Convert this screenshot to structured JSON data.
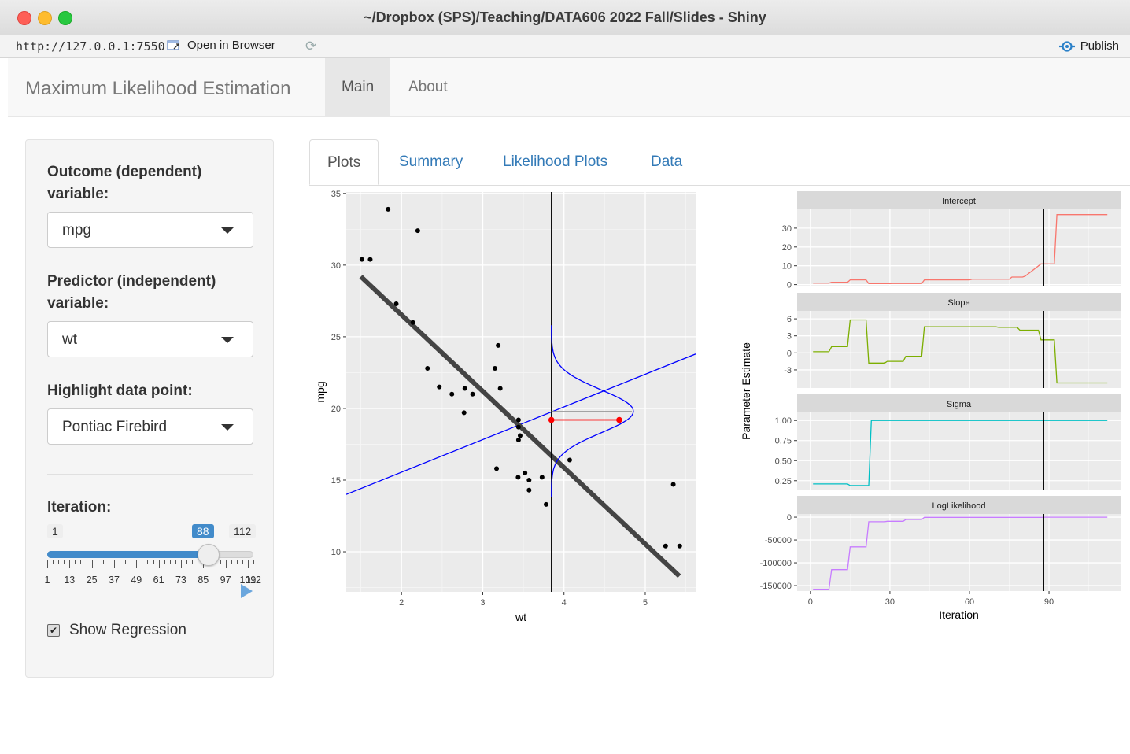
{
  "window": {
    "title": "~/Dropbox (SPS)/Teaching/DATA606 2022 Fall/Slides - Shiny"
  },
  "viewer": {
    "url": "http://127.0.0.1:7550",
    "open_label": "Open in Browser",
    "publish_label": "Publish"
  },
  "navbar": {
    "brand": "Maximum Likelihood Estimation",
    "items": [
      "Main",
      "About"
    ]
  },
  "sidebar": {
    "outcome_label_line1": "Outcome (dependent)",
    "outcome_label_line2": "variable:",
    "outcome_value": "mpg",
    "predictor_label_line1": "Predictor (independent)",
    "predictor_label_line2": "variable:",
    "predictor_value": "wt",
    "highlight_label": "Highlight data point:",
    "highlight_value": "Pontiac Firebird",
    "iteration_label": "Iteration:",
    "slider": {
      "min": "1",
      "max": "112",
      "value": "88",
      "ticks": [
        "1",
        "13",
        "25",
        "37",
        "49",
        "61",
        "73",
        "85",
        "97",
        "109",
        "112"
      ]
    },
    "show_regression_label": "Show Regression",
    "show_regression_checked": true
  },
  "tabs": [
    "Plots",
    "Summary",
    "Likelihood Plots",
    "Data"
  ],
  "colors": {
    "link": "#337ab7",
    "slider": "#428bca",
    "intercept": "#f8766d",
    "slope": "#7cae00",
    "sigma": "#00bfc4",
    "loglik": "#c77cff"
  },
  "chart_data": [
    {
      "type": "scatter",
      "xlabel": "wt",
      "ylabel": "mpg",
      "xticks": [
        "2",
        "3",
        "4",
        "5"
      ],
      "yticks": [
        "10",
        "15",
        "20",
        "25",
        "30",
        "35"
      ],
      "xlim": [
        1.32,
        5.62
      ],
      "ylim": [
        7.2,
        35.1
      ],
      "points": [
        [
          1.513,
          30.4
        ],
        [
          1.615,
          30.4
        ],
        [
          1.835,
          33.9
        ],
        [
          1.935,
          27.3
        ],
        [
          2.14,
          26.0
        ],
        [
          2.2,
          32.4
        ],
        [
          2.32,
          22.8
        ],
        [
          2.465,
          21.5
        ],
        [
          2.62,
          21.0
        ],
        [
          2.77,
          19.7
        ],
        [
          2.78,
          21.4
        ],
        [
          2.875,
          21.0
        ],
        [
          3.15,
          22.8
        ],
        [
          3.17,
          15.8
        ],
        [
          3.19,
          24.4
        ],
        [
          3.215,
          21.4
        ],
        [
          3.435,
          15.2
        ],
        [
          3.44,
          18.7
        ],
        [
          3.44,
          19.2
        ],
        [
          3.44,
          17.8
        ],
        [
          3.46,
          18.1
        ],
        [
          3.52,
          15.5
        ],
        [
          3.57,
          15.0
        ],
        [
          3.57,
          14.3
        ],
        [
          3.73,
          15.2
        ],
        [
          3.78,
          13.3
        ],
        [
          4.07,
          16.4
        ],
        [
          5.25,
          10.4
        ],
        [
          5.345,
          14.7
        ],
        [
          5.424,
          10.4
        ]
      ],
      "regression_line": {
        "x": [
          1.5,
          5.42
        ],
        "y": [
          29.2,
          8.3
        ],
        "color": "#444444"
      },
      "iteration_line": {
        "x": [
          1.32,
          5.62
        ],
        "y": [
          14.0,
          23.8
        ],
        "color": "#0000ff"
      },
      "highlight": {
        "x": 3.845,
        "y": 19.2,
        "fitted_y": 19.8,
        "color": "#ff0000",
        "density_sd": 1.5,
        "density_peak_x": 4.68
      }
    },
    {
      "type": "line",
      "xlabel": "Iteration",
      "ylabel": "Parameter Estimate",
      "xticks": [
        "0",
        "30",
        "60",
        "90"
      ],
      "xlim": [
        -5,
        117
      ],
      "vline": 88,
      "facets": [
        {
          "name": "Intercept",
          "yticks": [
            "0",
            "10",
            "20",
            "30"
          ],
          "ylim": [
            -1,
            40
          ],
          "color": "#f8766d",
          "x": [
            1,
            7,
            8,
            14,
            15,
            20,
            21,
            22,
            23,
            30,
            31,
            42,
            43,
            60,
            61,
            75,
            76,
            80,
            81,
            87,
            88,
            92,
            93,
            112
          ],
          "y": [
            0.8,
            0.8,
            1.2,
            1.2,
            2.5,
            2.5,
            2.5,
            0.5,
            0.5,
            0.5,
            0.6,
            0.6,
            2.5,
            2.5,
            2.9,
            2.9,
            4,
            4,
            4.5,
            11,
            11,
            11,
            37.2,
            37.2
          ]
        },
        {
          "name": "Slope",
          "yticks": [
            "-3",
            "0",
            "3",
            "6"
          ],
          "ylim": [
            -6.2,
            7.4
          ],
          "color": "#7cae00",
          "x": [
            1,
            7,
            8,
            14,
            15,
            21,
            22,
            28,
            29,
            35,
            36,
            42,
            43,
            70,
            71,
            78,
            79,
            86,
            87,
            92,
            93,
            112
          ],
          "y": [
            0.2,
            0.2,
            1.1,
            1.1,
            5.8,
            5.8,
            -1.8,
            -1.8,
            -1.5,
            -1.5,
            -0.6,
            -0.6,
            4.6,
            4.6,
            4.5,
            4.5,
            4,
            4,
            2.3,
            2.3,
            -5.3,
            -5.3
          ]
        },
        {
          "name": "Sigma",
          "yticks": [
            "0.25",
            "0.50",
            "0.75",
            "1.00"
          ],
          "ylim": [
            0.14,
            1.1
          ],
          "color": "#00bfc4",
          "x": [
            1,
            14,
            15,
            21,
            22,
            23,
            24,
            112
          ],
          "y": [
            0.21,
            0.21,
            0.19,
            0.19,
            0.19,
            1,
            1,
            1
          ]
        },
        {
          "name": "LogLikelihood",
          "yticks": [
            "-150000",
            "-100000",
            "-50000",
            "0"
          ],
          "ylim": [
            -162000,
            7000
          ],
          "color": "#c77cff",
          "x": [
            1,
            6,
            7,
            8,
            14,
            15,
            21,
            22,
            28,
            29,
            35,
            36,
            42,
            43,
            87,
            88,
            112
          ],
          "y": [
            -158000,
            -158000,
            -158000,
            -115000,
            -115000,
            -65000,
            -65000,
            -10000,
            -10000,
            -9000,
            -9000,
            -5000,
            -5000,
            -500,
            -500,
            0,
            0
          ]
        }
      ]
    }
  ]
}
